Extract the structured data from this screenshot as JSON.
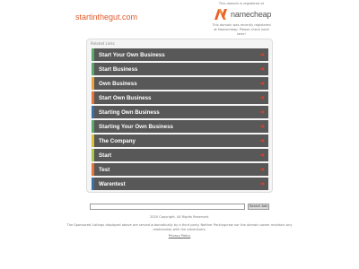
{
  "header": {
    "domain": "startinthegut.com",
    "registered_text": "This domain is registered at",
    "registrar_name": "namecheap",
    "registrar_note": "This domain was recently registered at Namecheap. Please check back later!"
  },
  "panel": {
    "title": "Related Links",
    "items": [
      {
        "label": "Start Your Own Business",
        "accent": "#5aa86a"
      },
      {
        "label": "Start Business",
        "accent": "#5aa86a"
      },
      {
        "label": "Own Business",
        "accent": "#e8a33a"
      },
      {
        "label": "Start Own Business",
        "accent": "#e8743a"
      },
      {
        "label": "Starting Own Business",
        "accent": "#3a6fa8"
      },
      {
        "label": "Starting Your Own Business",
        "accent": "#5aa86a"
      },
      {
        "label": "The Company",
        "accent": "#d9c23a"
      },
      {
        "label": "Start",
        "accent": "#a8c84a"
      },
      {
        "label": "Test",
        "accent": "#e8743a"
      },
      {
        "label": "Warentest",
        "accent": "#3a6fa8"
      }
    ],
    "arrow_icon": "arrow-right-icon",
    "arrow_color": "#e8402a"
  },
  "search": {
    "placeholder": "",
    "button_label": "Search Ads"
  },
  "footer": {
    "copyright": "2020 Copyright. All Rights Reserved.",
    "disclaimer": "The Sponsored Listings displayed above are served automatically by a third party. Neither Parkingcrew nor the domain owner maintain any relationship with the advertisers.",
    "privacy_label": "Privacy Policy"
  },
  "colors": {
    "domain": "#e05a2b",
    "link_background": "#585858",
    "registrar_logo": "#e8602a"
  }
}
